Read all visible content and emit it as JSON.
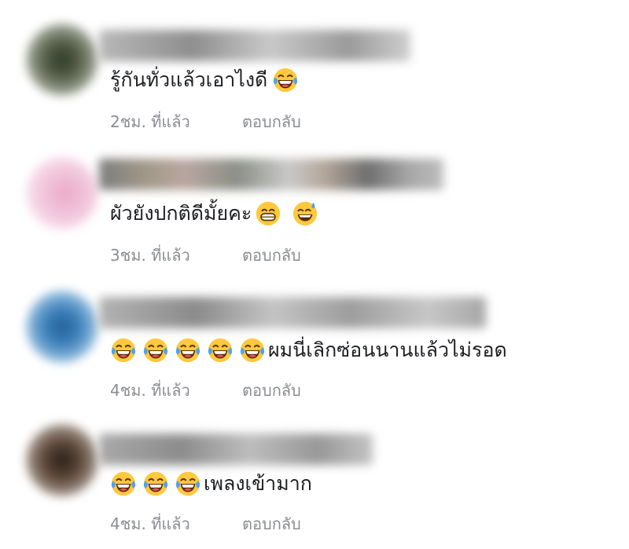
{
  "comments": [
    {
      "text": "รู้กันทั่วแล้วเอาไงดี",
      "emojis_before": [],
      "emojis_after": [
        "laughing-tears-emoji"
      ],
      "time": "2ชม. ที่แล้ว",
      "reply_label": "ตอบกลับ"
    },
    {
      "text": "ผัวยังปกติดีมั้ยคะ",
      "emojis_before": [],
      "emojis_after": [
        "grinning-emoji",
        "sweat-smile-emoji"
      ],
      "time": "3ชม. ที่แล้ว",
      "reply_label": "ตอบกลับ"
    },
    {
      "text": "ผมนี่เลิกซ่อนนานแล้วไม่รอด",
      "emojis_before": [
        "laughing-tears-emoji",
        "laughing-tears-emoji",
        "laughing-tears-emoji",
        "laughing-tears-emoji",
        "laughing-tears-emoji"
      ],
      "emojis_after": [],
      "time": "4ชม. ที่แล้ว",
      "reply_label": "ตอบกลับ"
    },
    {
      "text": "เพลงเข้ามาก",
      "emojis_before": [
        "laughing-tears-emoji",
        "laughing-tears-emoji",
        "laughing-tears-emoji"
      ],
      "emojis_after": [],
      "time": "4ชม. ที่แล้ว",
      "reply_label": "ตอบกลับ"
    }
  ],
  "colors": {
    "text": "#1c1e21",
    "meta": "#8a8d91",
    "emoji_face": "#ffc83d",
    "tear": "#4aa3f5"
  }
}
